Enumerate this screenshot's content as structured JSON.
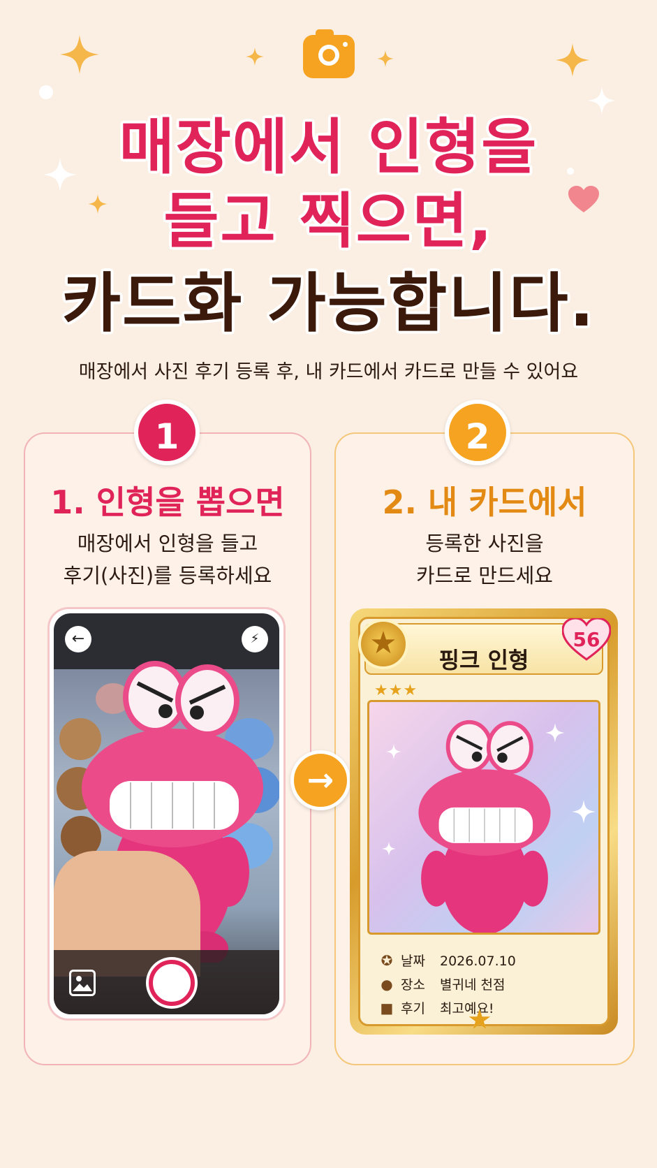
{
  "header": {
    "camera_icon": "camera-icon",
    "line1": "매장에서 인형을",
    "line2": "들고 찍으면,",
    "line3": "카드화 가능합니다.",
    "subtitle": "매장에서 사진 후기 등록 후, 내 카드에서 카드로 만들 수 있어요"
  },
  "steps": [
    {
      "number": "1",
      "title": "1. 인형을 뽑으면",
      "desc_line1": "매장에서 인형을 들고",
      "desc_line2": "후기(사진)를 등록하세요"
    },
    {
      "number": "2",
      "title": "2. 내 카드에서",
      "desc_line1": "등록한 사진을",
      "desc_line2": "카드로 만드세요"
    }
  ],
  "phone": {
    "back_icon": "←",
    "flash_icon": "⚡"
  },
  "card": {
    "name": "핑크 인형",
    "level": "56",
    "stars": "★★★",
    "date_label": "날짜",
    "date_value": "2026.07.10",
    "place_label": "장소",
    "place_value": "별귀네 천점",
    "review_label": "후기",
    "review_value": "최고예요!"
  },
  "colors": {
    "background": "#fbefe3",
    "accent_pink": "#e0245a",
    "accent_orange": "#f5a320",
    "dark_brown": "#3b1a0c",
    "card_gold": "#d89a2c"
  }
}
